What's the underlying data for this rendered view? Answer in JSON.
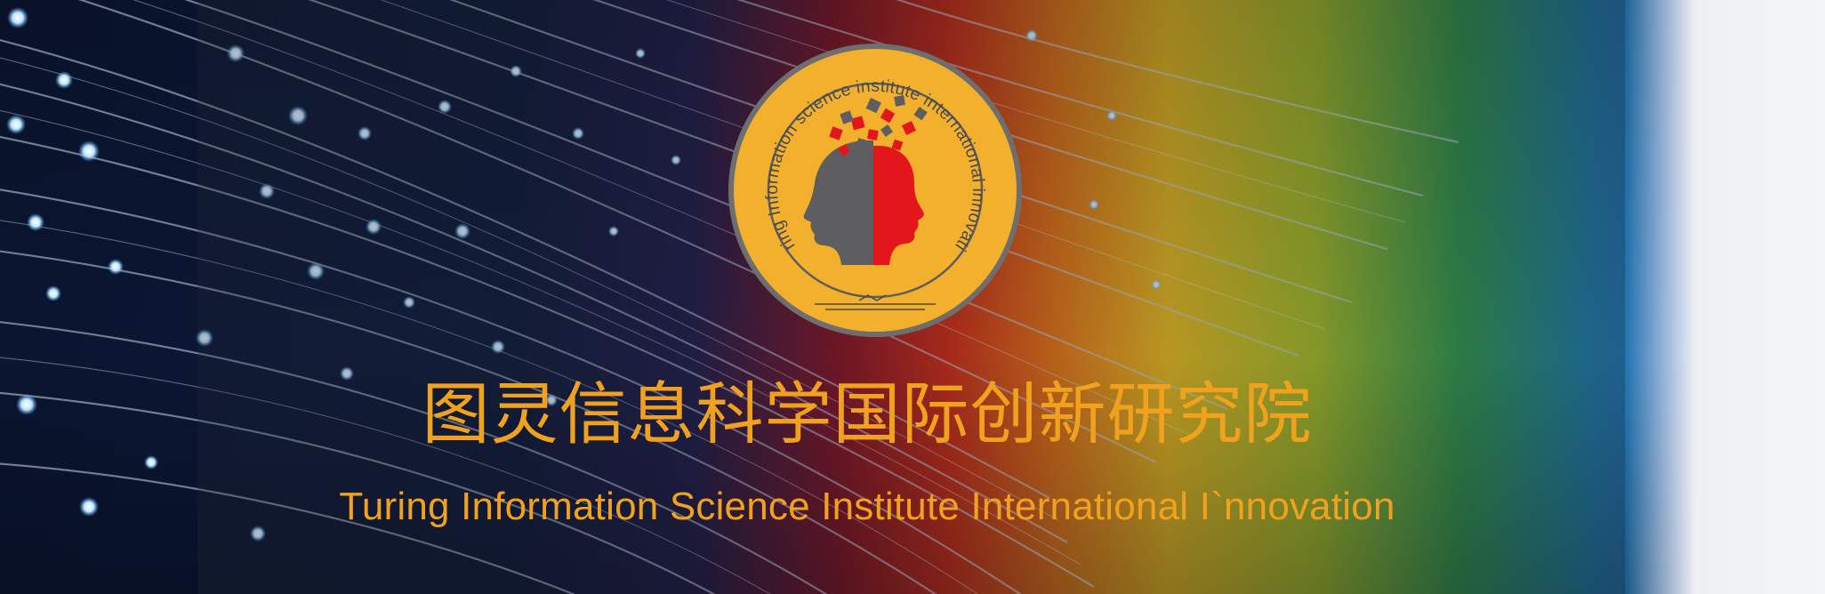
{
  "banner": {
    "title_cn": "图灵信息科学国际创新研究院",
    "title_en": "Turing Information Science Institute International I`nnovation"
  },
  "logo": {
    "ring_text": "Turing Information science institute international innovation"
  },
  "colors": {
    "accent": "#f0a21e",
    "emblem_fill": "#f3b02c",
    "emblem_border": "#6e6e6e",
    "head_gray": "#5e5e60",
    "head_red": "#e3161c"
  }
}
